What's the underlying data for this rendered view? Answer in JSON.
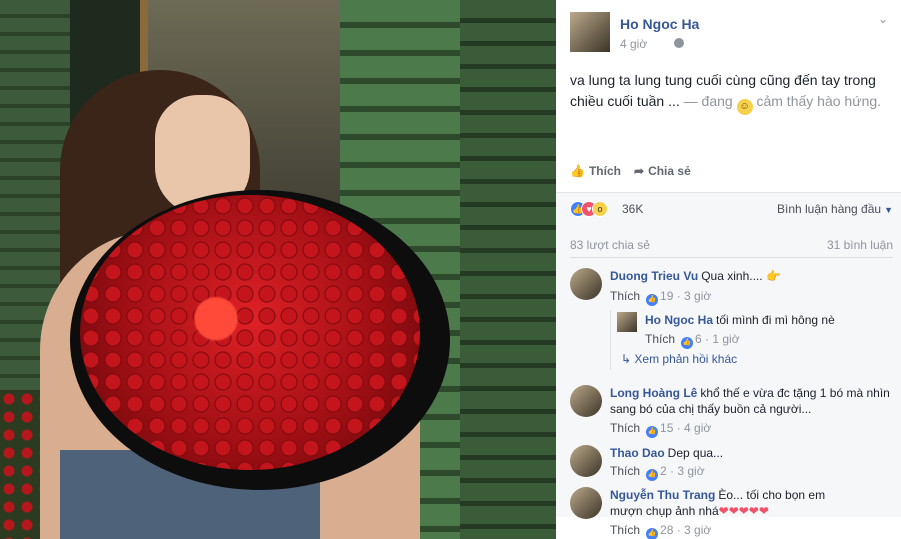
{
  "post": {
    "author": "Ho Ngoc Ha",
    "time": "4 giờ",
    "text_main": "va lung ta lung tung cuối cùng cũng đến tay trong chiều cuối tuần ...",
    "text_feeling_prefix": "— đang",
    "text_feeling": "cảm thấy hào hứng.",
    "icons": {
      "privacy": "globe-icon",
      "menu": "chevron-down-icon",
      "feeling": "smile-emoji-icon"
    }
  },
  "actions": {
    "like_label": "Thích",
    "share_label": "Chia sẻ"
  },
  "reactions": {
    "count": "36K",
    "sort_label": "Bình luận hàng đầu",
    "shares": "83 lượt chia sẻ",
    "comments": "31 bình luận"
  },
  "comments": [
    {
      "name": "Duong Trieu Vu",
      "text": "Qua xinh....",
      "emoji": "👉",
      "like_label": "Thích",
      "likes": "19",
      "time": "3 giờ"
    },
    {
      "name": "Ho Ngoc Ha",
      "text": "tối mình đi mì hông nè",
      "like_label": "Thích",
      "likes": "6",
      "time": "1 giờ",
      "is_reply": true
    },
    {
      "name": "Long Hoàng Lê",
      "text": "khổ thế e vừa đc tặng 1 bó mà nhìn sang bó của chị thấy buồn cả người...",
      "like_label": "Thích",
      "likes": "15",
      "time": "4 giờ"
    },
    {
      "name": "Thao Dao",
      "text": "Dep qua...",
      "like_label": "Thích",
      "likes": "2",
      "time": "3 giờ"
    },
    {
      "name": "Nguyễn Thu Trang",
      "text": "Èo... tối cho bọn em mượn chụp ảnh nhá",
      "hearts": "❤❤❤❤❤",
      "like_label": "Thích",
      "likes": "28",
      "time": "3 giờ"
    }
  ],
  "more_replies": "Xem phản hồi khác",
  "colors": {
    "link_blue": "#365899",
    "grey": "#90949c",
    "like_blue": "#4080ff",
    "love_red": "#f25268"
  }
}
